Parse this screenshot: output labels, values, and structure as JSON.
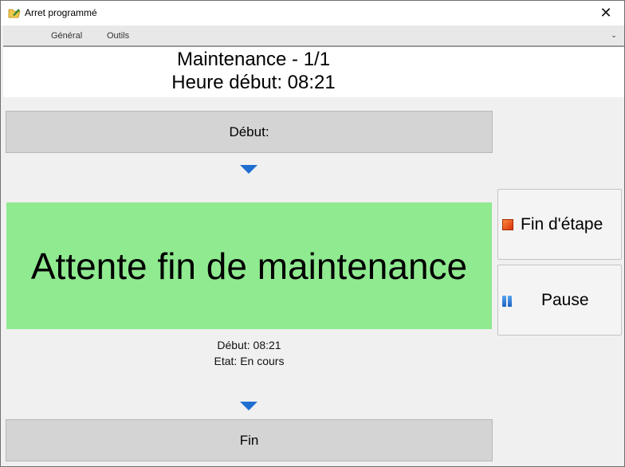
{
  "window": {
    "title": "Arret programmé",
    "close_glyph": "✕",
    "icon": "folder-pencil-icon"
  },
  "menu": {
    "items": [
      "Général",
      "Outils"
    ],
    "expand_glyph": "⌄"
  },
  "header": {
    "line1": "Maintenance - 1/1",
    "line2": "Heure début: 08:21"
  },
  "steps": {
    "start_label": "Début:",
    "current_label": "Attente fin de maintenance",
    "current_color": "#90ea90",
    "current_start": "Début: 08:21",
    "current_state": "Etat: En cours",
    "end_label": "Fin"
  },
  "actions": {
    "end_step_label": "Fin d'étape",
    "pause_label": "Pause"
  },
  "colors": {
    "arrow": "#1f6fd1",
    "step_gray": "#d4d4d4"
  }
}
